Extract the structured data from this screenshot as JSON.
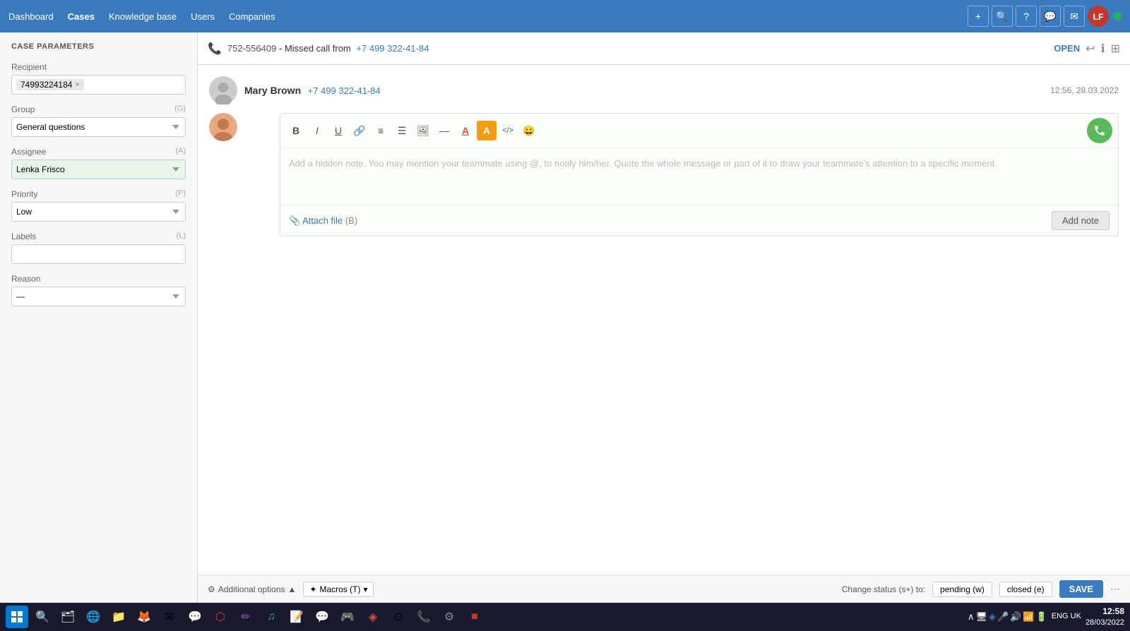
{
  "topnav": {
    "links": [
      {
        "label": "Dashboard",
        "active": false,
        "name": "dashboard"
      },
      {
        "label": "Cases",
        "active": true,
        "name": "cases"
      },
      {
        "label": "Knowledge base",
        "active": false,
        "name": "knowledge-base"
      },
      {
        "label": "Users",
        "active": false,
        "name": "users"
      },
      {
        "label": "Companies",
        "active": false,
        "name": "companies"
      }
    ],
    "icons": [
      {
        "name": "add-icon",
        "symbol": "+"
      },
      {
        "name": "search-icon",
        "symbol": "🔍"
      },
      {
        "name": "help-icon",
        "symbol": "?"
      },
      {
        "name": "chat-icon",
        "symbol": "💬"
      },
      {
        "name": "email-icon",
        "symbol": "✉"
      }
    ]
  },
  "sidebar": {
    "title": "CASE PARAMETERS",
    "recipient_label": "Recipient",
    "recipient_value": "74993224184",
    "group_label": "Group",
    "group_shortcut": "(G)",
    "group_value": "General questions",
    "assignee_label": "Assignee",
    "assignee_shortcut": "(A)",
    "assignee_value": "Lenka Frisco",
    "priority_label": "Priority",
    "priority_shortcut": "(P)",
    "priority_value": "Low",
    "labels_label": "Labels",
    "labels_shortcut": "(L)",
    "reason_label": "Reason",
    "reason_value": "—",
    "additional_options": "Additional options"
  },
  "case_header": {
    "phone_number": "752-556409",
    "missed_text": "- Missed call from",
    "caller_number": "+7 499 322-41-84",
    "status": "OPEN"
  },
  "message": {
    "sender_name": "Mary Brown",
    "sender_phone": "+7 499 322-41-84",
    "timestamp": "12:56, 28.03.2022",
    "note_placeholder": "Add a hidden note. You may mention your teammate using @, to notify him/her. Quote the whole message or part of it to draw your teammate's attention to a specific moment.",
    "attach_label": "Attach file",
    "attach_shortcut": "(B)",
    "add_note_label": "Add note"
  },
  "toolbar_buttons": [
    {
      "name": "bold-btn",
      "symbol": "B",
      "bold": true
    },
    {
      "name": "italic-btn",
      "symbol": "I",
      "italic": true
    },
    {
      "name": "underline-btn",
      "symbol": "U",
      "underline": true
    },
    {
      "name": "link-btn",
      "symbol": "🔗"
    },
    {
      "name": "list-ordered-btn",
      "symbol": "≡"
    },
    {
      "name": "list-unordered-btn",
      "symbol": "☰"
    },
    {
      "name": "image-btn",
      "symbol": "🖼"
    },
    {
      "name": "divider-btn",
      "symbol": "—"
    },
    {
      "name": "font-color-btn",
      "symbol": "A"
    },
    {
      "name": "bg-color-btn",
      "symbol": "A"
    },
    {
      "name": "code-btn",
      "symbol": "</>"
    },
    {
      "name": "emoji-btn",
      "symbol": "😀"
    }
  ],
  "bottom_bar": {
    "additional_options": "Additional options",
    "macros_label": "Macros (T)",
    "change_status_label": "Change status (s+) to:",
    "pending_label": "pending (w)",
    "closed_label": "closed (e)",
    "save_label": "SAVE"
  },
  "taskbar": {
    "time": "12:58",
    "date": "28/03/2022",
    "locale": "ENG\nUK"
  }
}
